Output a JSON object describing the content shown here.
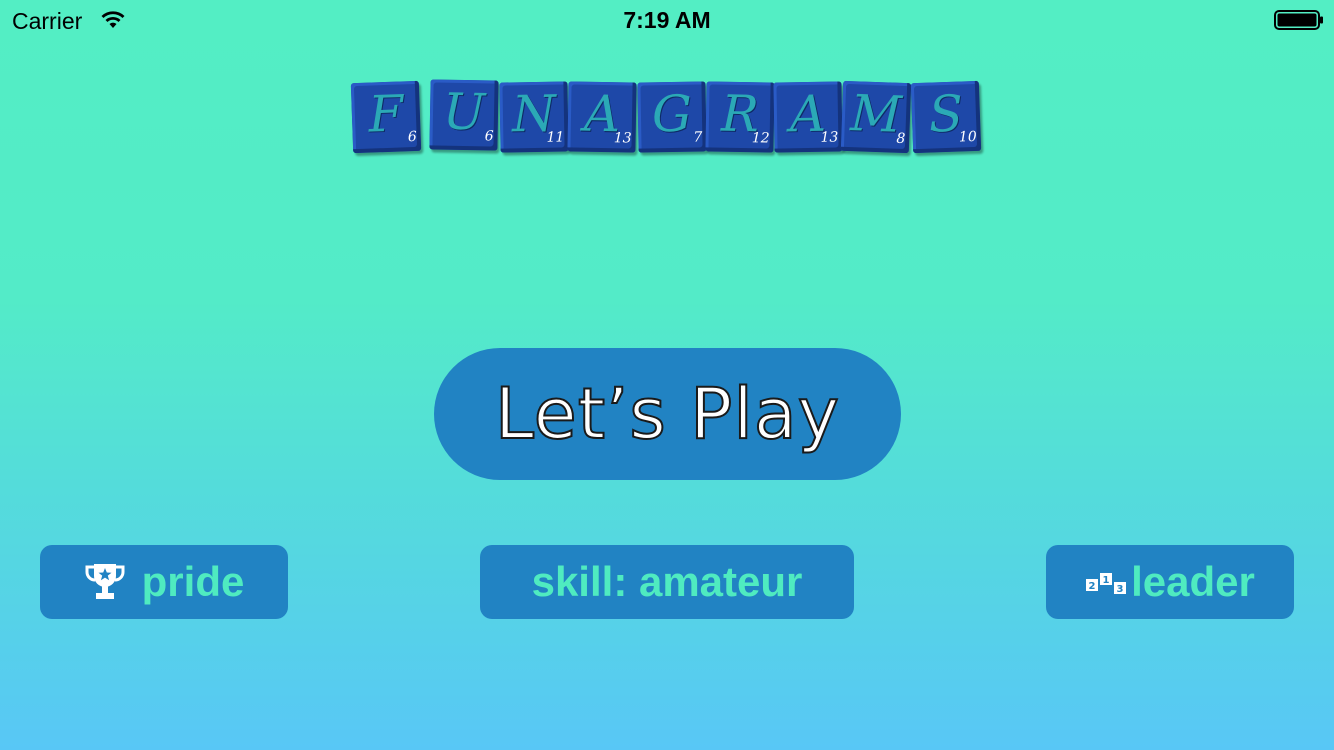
{
  "status_bar": {
    "carrier": "Carrier",
    "time": "7:19 AM",
    "wifi_icon": "wifi-icon",
    "battery_icon": "battery-icon"
  },
  "logo": {
    "tiles": [
      {
        "letter": "F",
        "score": "6"
      },
      {
        "letter": "U",
        "score": "6"
      },
      {
        "letter": "N",
        "score": "11"
      },
      {
        "letter": "A",
        "score": "13"
      },
      {
        "letter": "G",
        "score": "7"
      },
      {
        "letter": "R",
        "score": "12"
      },
      {
        "letter": "A",
        "score": "13"
      },
      {
        "letter": "M",
        "score": "8"
      },
      {
        "letter": "S",
        "score": "10"
      }
    ]
  },
  "main": {
    "play_label": "Let’s Play"
  },
  "bottom": {
    "pride_label": "pride",
    "pride_icon": "trophy-icon",
    "skill_label": "skill: amateur",
    "leader_label": "leader",
    "leader_icon": "podium-icon"
  },
  "colors": {
    "background_top": "#53EEC4",
    "background_bottom": "#58C7F6",
    "button": "#2183C3",
    "button_text": "#4FEBC0",
    "tile": "#1E48A8",
    "tile_letter": "#2BA9B6"
  }
}
